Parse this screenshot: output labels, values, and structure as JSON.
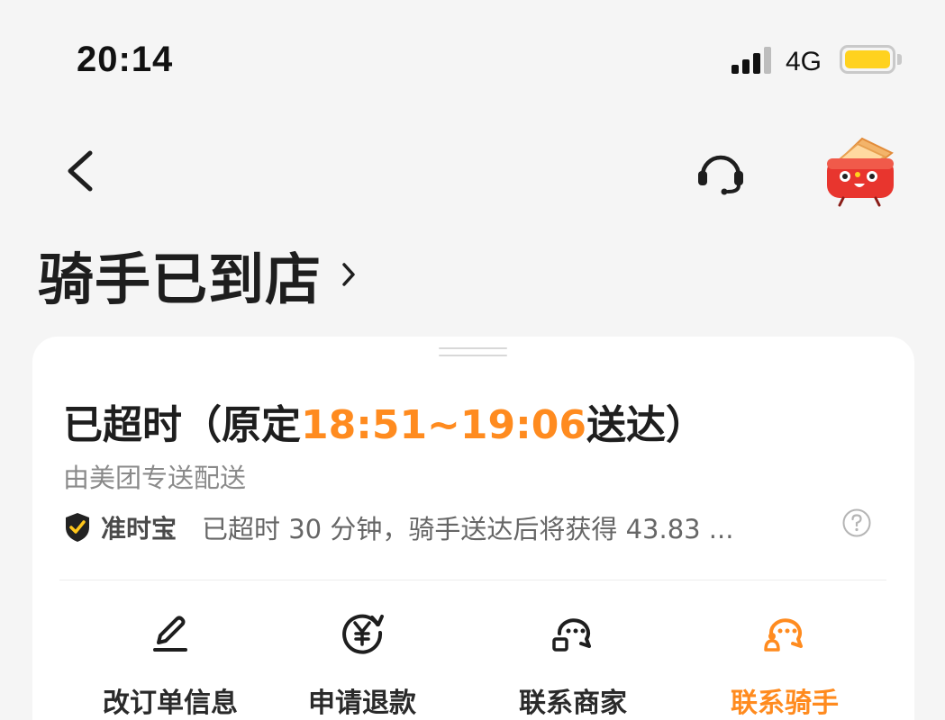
{
  "status_bar": {
    "time": "20:14",
    "network": "4G",
    "battery_color": "#ffd21f"
  },
  "nav": {
    "back_icon": "chevron-left-icon",
    "service_icon": "headset-icon",
    "mascot_icon": "red-envelope-mascot-icon"
  },
  "order_status": {
    "title": "骑手已到店"
  },
  "card": {
    "delay_prefix": "已超时（原定",
    "delay_time": "18:51~19:06",
    "delay_suffix": "送达）",
    "carrier": "由美团专送配送",
    "guarantee_name": "准时宝",
    "guarantee_desc": "已超时 30 分钟，骑手送达后将获得 43.83 ...",
    "accent_color": "#ff8b1f"
  },
  "actions": [
    {
      "label": "改订单信息",
      "icon": "edit-icon"
    },
    {
      "label": "申请退款",
      "icon": "refund-icon"
    },
    {
      "label": "联系商家",
      "icon": "merchant-chat-icon"
    },
    {
      "label": "联系骑手",
      "icon": "rider-chat-icon"
    }
  ]
}
